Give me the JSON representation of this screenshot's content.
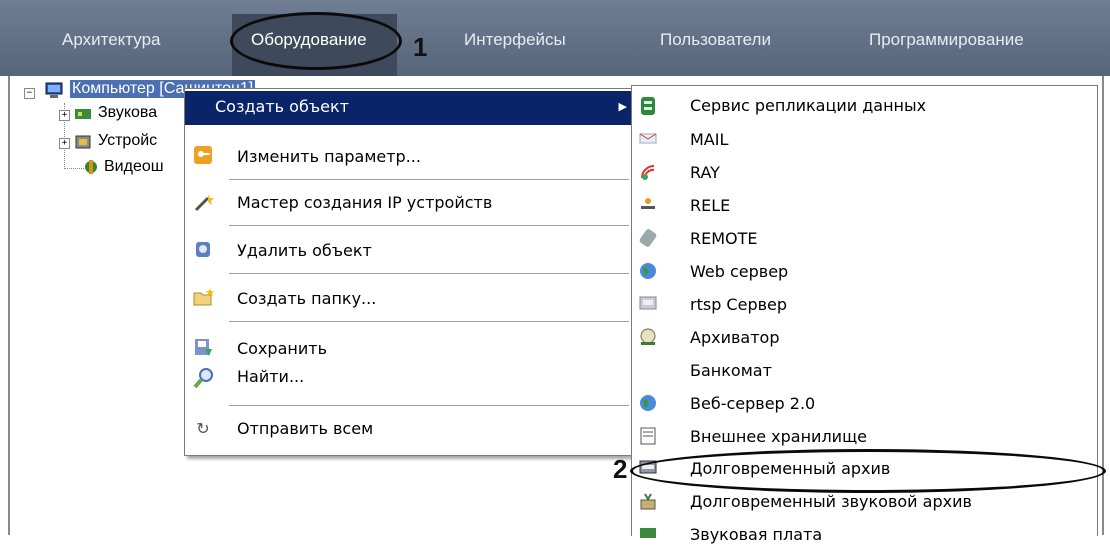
{
  "tabs": [
    "Архитектура",
    "Оборудование",
    "Интерфейсы",
    "Пользователи",
    "Программирование"
  ],
  "callouts": {
    "one": "1",
    "two": "2"
  },
  "tree": {
    "root": "Компьютер [Сашинтон1]",
    "children": [
      "Звукова",
      "Устройс",
      "Видеош"
    ]
  },
  "context_menu": {
    "items": [
      {
        "label": "Создать объект",
        "icon": "none",
        "highlighted": true
      },
      {
        "label": "Изменить параметр...",
        "icon": "key-icon"
      },
      {
        "label": "Мастер создания IP устройств",
        "icon": "wand-icon"
      },
      {
        "label": "Удалить объект",
        "icon": "delete-icon"
      },
      {
        "label": "Создать папку...",
        "icon": "new-folder-icon"
      },
      {
        "label": "Сохранить",
        "icon": "save-icon"
      },
      {
        "label": "Найти...",
        "icon": "magnifier-icon"
      },
      {
        "label": "Отправить всем",
        "icon": "refresh-icon"
      }
    ]
  },
  "submenu": {
    "items": [
      {
        "label": "Сервис репликации данных",
        "icon": "database-icon"
      },
      {
        "label": "MAIL",
        "icon": "mail-icon"
      },
      {
        "label": "RAY",
        "icon": "signal-icon"
      },
      {
        "label": "RELE",
        "icon": "relay-icon"
      },
      {
        "label": "REMOTE",
        "icon": "remote-icon"
      },
      {
        "label": "Web сервер",
        "icon": "globe-icon"
      },
      {
        "label": "rtsp Сервер",
        "icon": "rtsp-icon"
      },
      {
        "label": "Архиватор",
        "icon": "archiver-icon"
      },
      {
        "label": "Банкомат",
        "icon": "none"
      },
      {
        "label": "Веб-сервер 2.0",
        "icon": "globe-icon"
      },
      {
        "label": "Внешнее хранилище",
        "icon": "storage-icon"
      },
      {
        "label": "Долговременный архив",
        "icon": "archive-icon",
        "highlighted": true
      },
      {
        "label": "Долговременный звуковой архив",
        "icon": "audio-archive-icon"
      },
      {
        "label": "Звуковая плата",
        "icon": "sound-card-icon"
      }
    ]
  },
  "colors": {
    "tabbar": "#5f6e82",
    "highlight": "#0a246a"
  }
}
